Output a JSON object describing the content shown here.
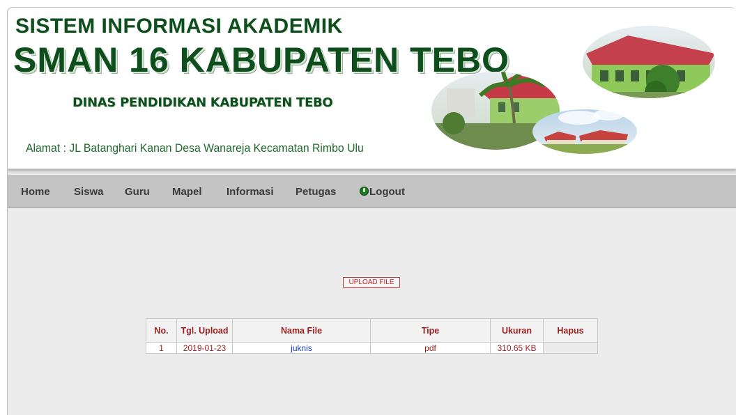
{
  "header": {
    "title_line1": "SISTEM INFORMASI AKADEMIK",
    "title_line2": "SMAN 16 KABUPATEN TEBO",
    "subtitle": "DINAS PENDIDIKAN KABUPATEN TEBO",
    "address": "Alamat : JL Batanghari Kanan Desa Wanareja Kecamatan Rimbo Ulu"
  },
  "nav": {
    "items": [
      "Home",
      "Siswa",
      "Guru",
      "Mapel",
      "Informasi",
      "Petugas"
    ],
    "logout_label": "Logout",
    "logout_icon": "power-icon"
  },
  "content": {
    "upload_button": "UPLOAD FILE",
    "table": {
      "headers": [
        "No.",
        "Tgl. Upload",
        "Nama File",
        "Tipe",
        "Ukuran",
        "Hapus"
      ],
      "rows": [
        {
          "no": "1",
          "tgl_upload": "2019-01-23",
          "nama_file": "juknis",
          "tipe": "pdf",
          "ukuran": "310.65 KB",
          "hapus": ""
        }
      ]
    }
  },
  "colors": {
    "title_green": "#0e4d1c",
    "nav_bg": "#c4c4c4",
    "header_red": "#9a1f1f",
    "link_blue": "#1a3cc8"
  }
}
